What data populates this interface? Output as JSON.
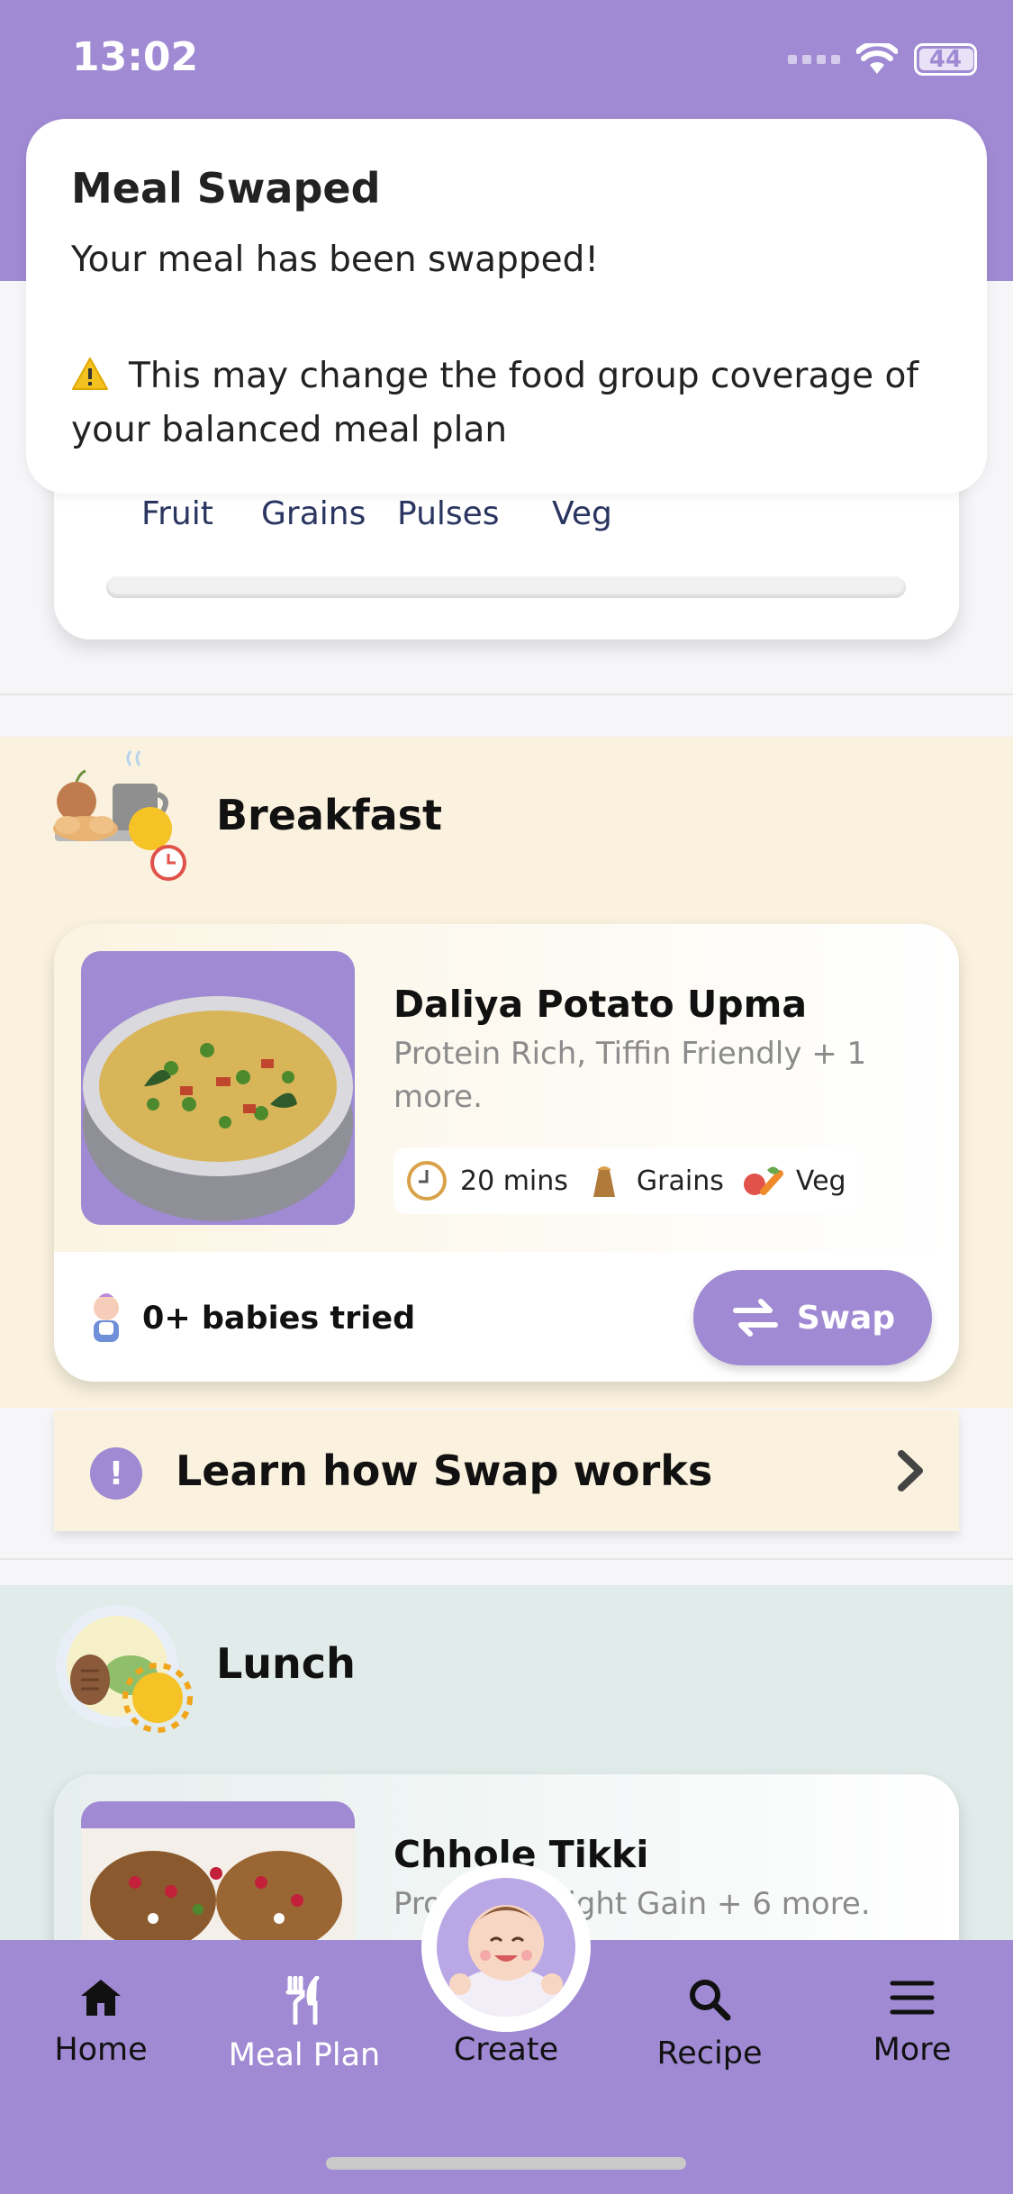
{
  "status_bar": {
    "time": "13:02",
    "battery": "44",
    "battery_level": 0.44
  },
  "toast": {
    "title": "Meal Swaped",
    "message": "Your meal has been swapped!",
    "warning_icon": "warning-icon",
    "warning": "This may change the food group coverage of your balanced meal plan"
  },
  "goal_card": {
    "food_groups": [
      "Fruit",
      "Grains",
      "Pulses",
      "Veg"
    ]
  },
  "breakfast": {
    "title": "Breakfast",
    "meal": {
      "name": "Daliya Potato Upma",
      "tags": "Protein Rich, Tiffin Friendly + 1 more.",
      "time": "20 mins",
      "group1": "Grains",
      "group2": "Veg",
      "babies": "0+ babies tried",
      "swap_label": "Swap"
    }
  },
  "learn": {
    "label": "Learn how Swap works",
    "icon": "!"
  },
  "lunch": {
    "title": "Lunch",
    "meal": {
      "name": "Chhole Tikki",
      "tags": "Protein, Weight Gain + 6 more."
    }
  },
  "nav": {
    "home": "Home",
    "meal_plan": "Meal Plan",
    "create": "Create",
    "recipe": "Recipe",
    "more": "More"
  },
  "colors": {
    "brand_purple": "#a08ad3",
    "breakfast_bg": "#faf2de",
    "lunch_bg": "#e1ebe9",
    "food_group_text": "#2a3560"
  }
}
